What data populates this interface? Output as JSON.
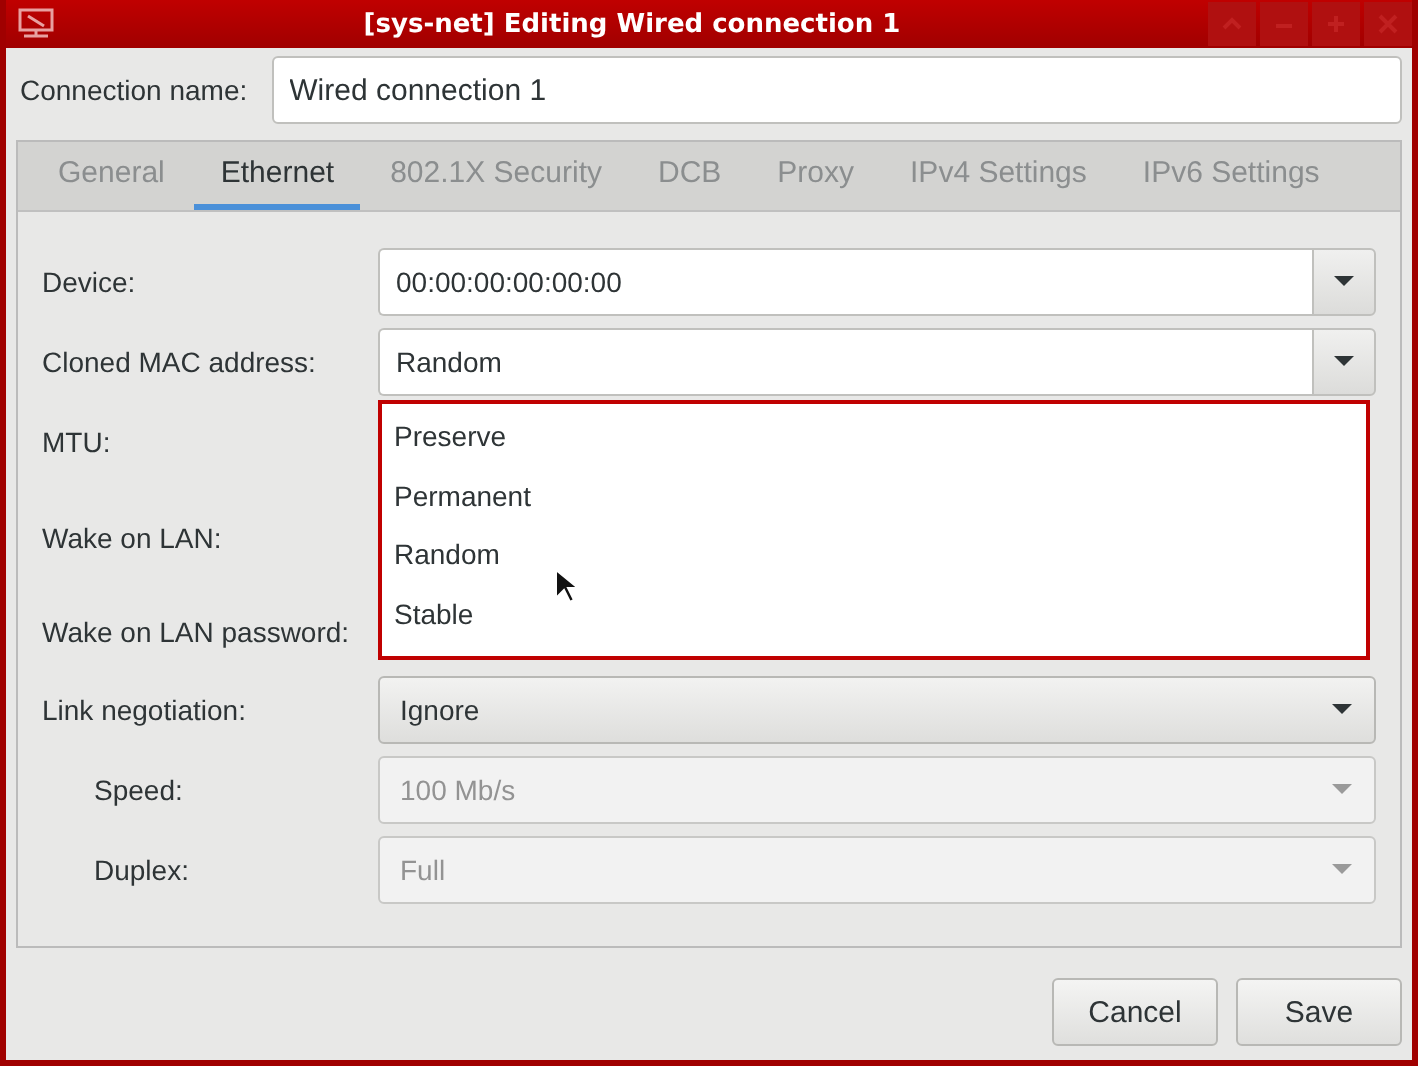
{
  "window": {
    "title": "[sys-net] Editing Wired connection 1"
  },
  "connection_name": {
    "label": "Connection name:",
    "value": "Wired connection 1"
  },
  "tabs": [
    {
      "label": "General",
      "selected": false
    },
    {
      "label": "Ethernet",
      "selected": true
    },
    {
      "label": "802.1X Security",
      "selected": false
    },
    {
      "label": "DCB",
      "selected": false
    },
    {
      "label": "Proxy",
      "selected": false
    },
    {
      "label": "IPv4 Settings",
      "selected": false
    },
    {
      "label": "IPv6 Settings",
      "selected": false
    }
  ],
  "fields": [
    {
      "label": "Device:",
      "kind": "combo-entry",
      "value": "00:00:00:00:00:00",
      "disabled": false
    },
    {
      "label": "Cloned MAC address:",
      "kind": "combo-entry",
      "value": "Random",
      "disabled": false
    },
    {
      "label": "MTU:",
      "kind": "covered"
    },
    {
      "label": "Wake on LAN:",
      "kind": "covered"
    },
    {
      "label": "Wake on LAN password:",
      "kind": "covered"
    },
    {
      "label": "Link negotiation:",
      "kind": "combo",
      "value": "Ignore",
      "disabled": false,
      "children": [
        {
          "label": "Speed:",
          "kind": "combo",
          "value": "100 Mb/s",
          "disabled": true
        },
        {
          "label": "Duplex:",
          "kind": "combo",
          "value": "Full",
          "disabled": true
        }
      ]
    }
  ],
  "popup": {
    "items": [
      "Preserve",
      "Permanent",
      "Random",
      "Stable"
    ]
  },
  "buttons": [
    "Cancel",
    "Save"
  ]
}
